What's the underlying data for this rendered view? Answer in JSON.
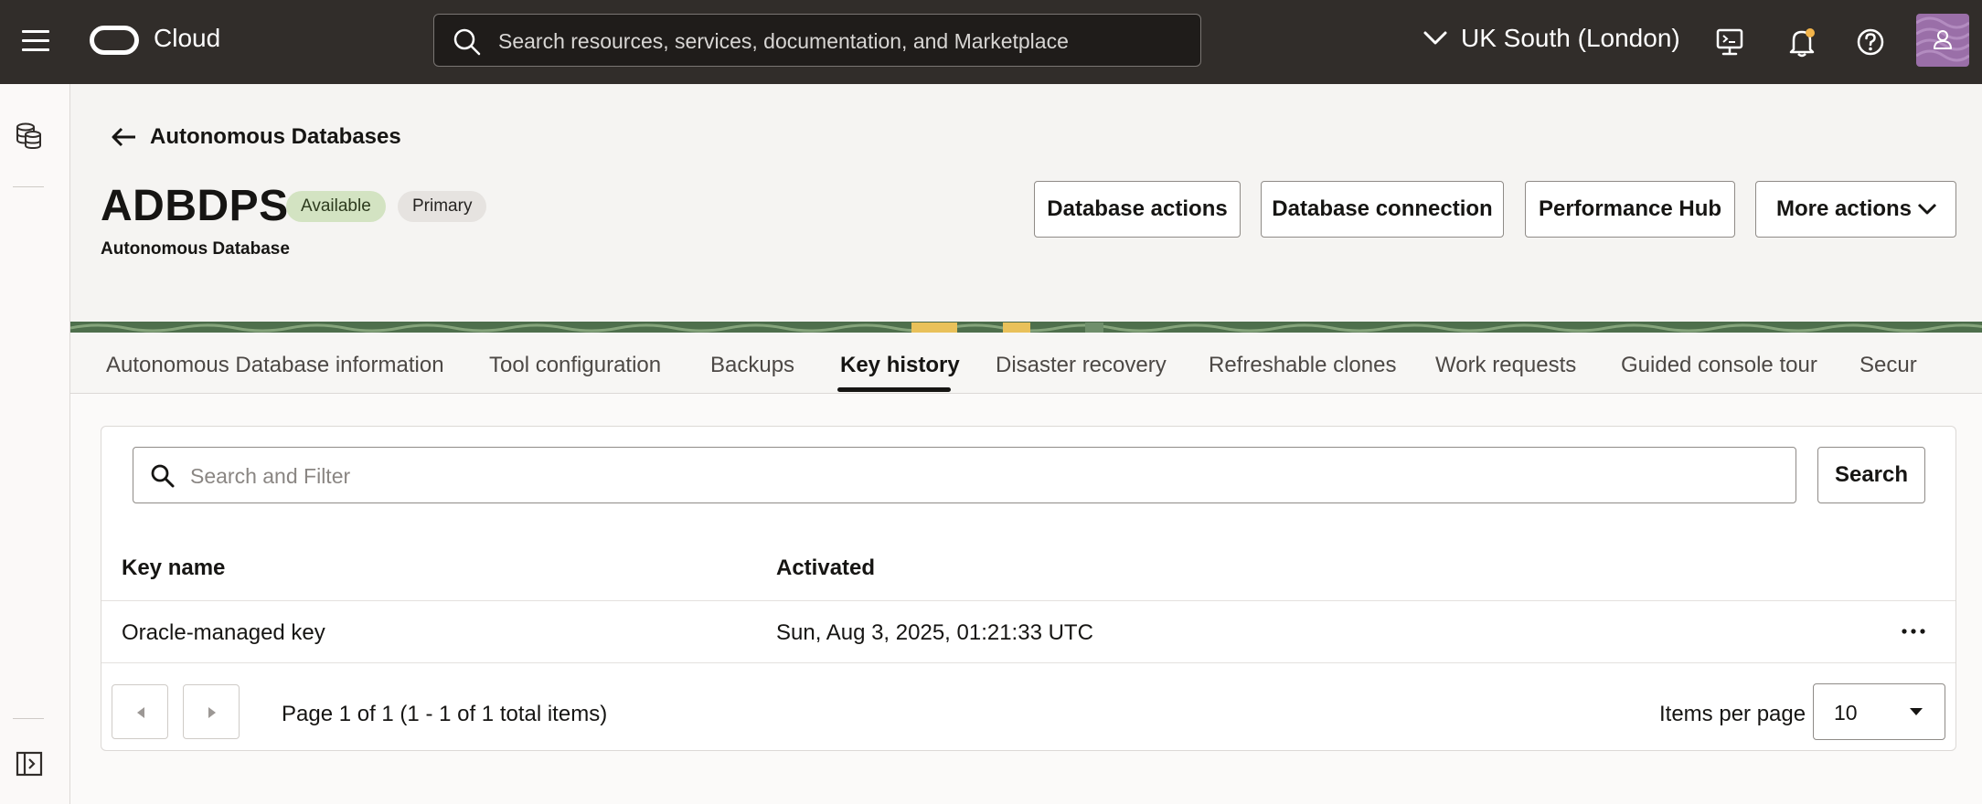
{
  "topbar": {
    "menu_icon": "hamburger-icon",
    "logo_text": "Cloud",
    "search_placeholder": "Search resources, services, documentation, and Marketplace",
    "region": "UK South (London)",
    "icons": [
      "cloud-shell-icon",
      "notifications-icon",
      "help-icon",
      "user-avatar-icon"
    ]
  },
  "rail": {
    "icons": [
      "database-stack-icon",
      "collapse-panel-icon"
    ]
  },
  "header": {
    "back_label": "Autonomous Databases",
    "title": "ADBDPS",
    "badges": [
      "Available",
      "Primary"
    ],
    "subtitle": "Autonomous Database",
    "actions": [
      "Database actions",
      "Database connection",
      "Performance Hub",
      "More actions"
    ]
  },
  "tabs": {
    "items": [
      "Autonomous Database information",
      "Tool configuration",
      "Backups",
      "Key history",
      "Disaster recovery",
      "Refreshable clones",
      "Work requests",
      "Guided console tour",
      "Secur"
    ],
    "active": "Key history"
  },
  "table": {
    "filter_placeholder": "Search and Filter",
    "search_button": "Search",
    "columns": [
      "Key name",
      "Activated"
    ],
    "rows": [
      {
        "key_name": "Oracle-managed key",
        "activated": "Sun, Aug 3, 2025, 01:21:33 UTC"
      }
    ]
  },
  "pagination": {
    "summary": "Page 1 of 1 (1 - 1 of 1 total items)",
    "items_per_page_label": "Items per page",
    "items_per_page": "10"
  },
  "colors": {
    "topbar": "#312d2a",
    "available_badge": "#d3e3c2",
    "primary_badge": "#e6e3e0",
    "avatar": "#9a6fa8"
  }
}
